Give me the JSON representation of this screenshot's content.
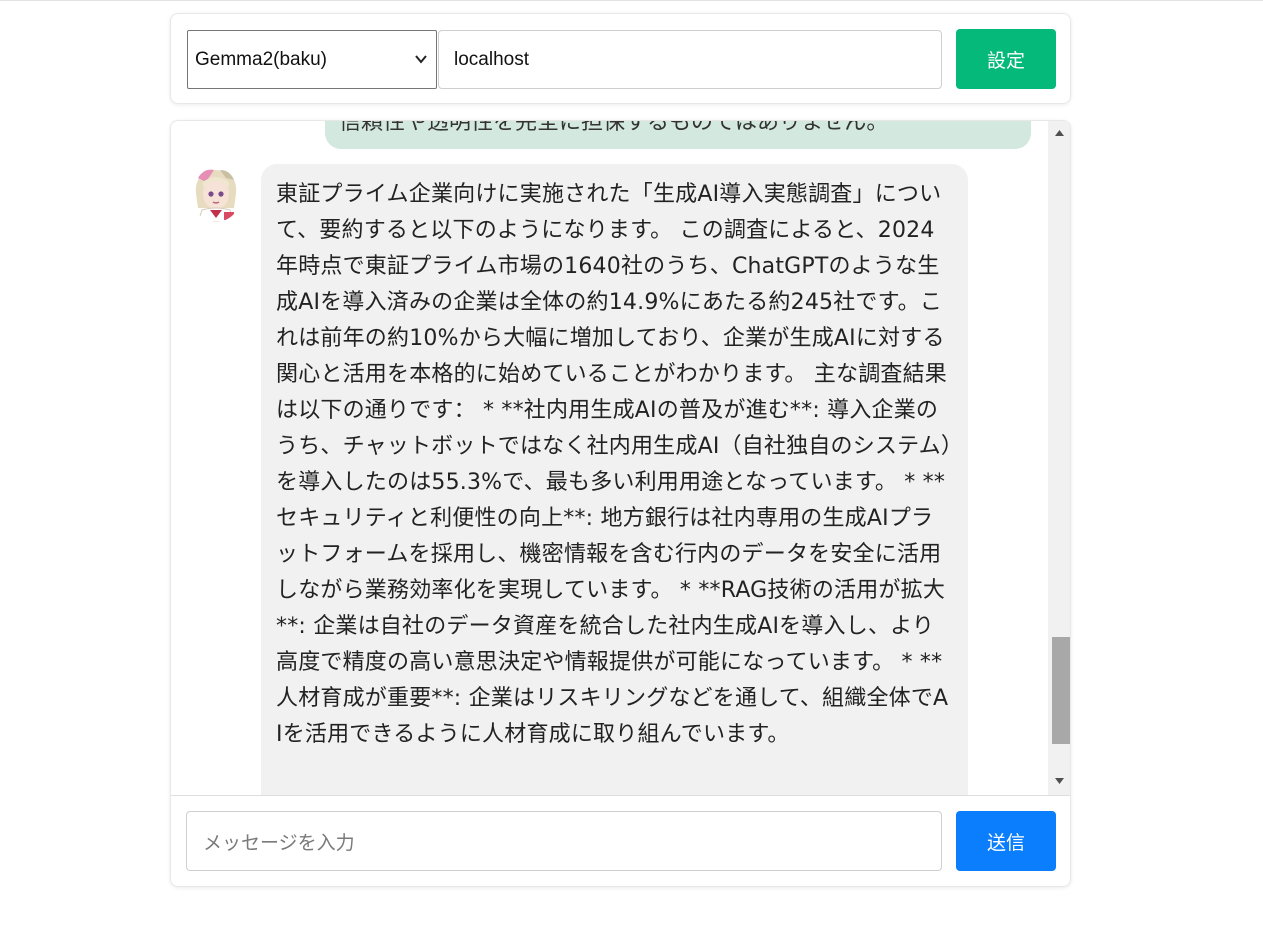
{
  "settings": {
    "model_select_value": "Gemma2(baku)",
    "host_value": "localhost",
    "set_label": "設定"
  },
  "chat": {
    "user_message_partial": "信頼性や透明性を完全に担保するものではありません。",
    "ai_message": "東証プライム企業向けに実施された「生成AI導入実態調査」について、要約すると以下のようになります。 この調査によると、2024年時点で東証プライム市場の1640社のうち、ChatGPTのような生成AIを導入済みの企業は全体の約14.9%にあたる約245社です。これは前年の約10%から大幅に増加しており、企業が生成AIに対する関心と活用を本格的に始めていることがわかります。 主な調査結果は以下の通りです： * **社内用生成AIの普及が進む**: 導入企業のうち、チャットボットではなく社内用生成AI（自社独自のシステム）を導入したのは55.3%で、最も多い利用用途となっています。 * **セキュリティと利便性の向上**: 地方銀行は社内専用の生成AIプラットフォームを採用し、機密情報を含む行内のデータを安全に活用しながら業務効率化を実現しています。 * **RAG技術の活用が拡大**: 企業は自社のデータ資産を統合した社内生成AIを導入し、より高度で精度の高い意思決定や情報提供が可能になっています。 * **人材育成が重要**: 企業はリスキリングなどを通して、組織全体でAIを活用できるように人材育成に取り組んでいます。",
    "scroll_position": 0.85
  },
  "composer": {
    "placeholder": "メッセージを入力",
    "send_label": "送信"
  },
  "colors": {
    "set_button": "#05b97b",
    "send_button": "#0a7efc",
    "user_bubble": "#d3e8df",
    "ai_bubble": "#f1f1f1"
  }
}
